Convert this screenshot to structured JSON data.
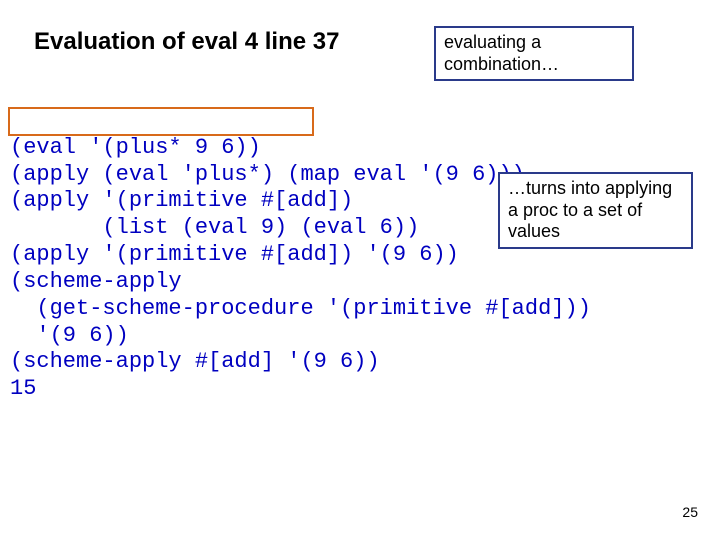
{
  "title": "Evaluation of eval 4 line 37",
  "annotation_top": "evaluating a combination…",
  "annotation_right": "…turns into applying a proc to a set of values",
  "code": {
    "l1": "(eval '(plus* 9 6))",
    "l2": "(apply (eval 'plus*) (map eval '(9 6)))",
    "l3": "(apply '(primitive #[add])",
    "l4": "       (list (eval 9) (eval 6))",
    "l5": "(apply '(primitive #[add]) '(9 6))",
    "l6": "(scheme-apply",
    "l7": "  (get-scheme-procedure '(primitive #[add]))",
    "l8": "  '(9 6))",
    "l9": "(scheme-apply #[add] '(9 6))",
    "l10": "15"
  },
  "page_number": "25"
}
